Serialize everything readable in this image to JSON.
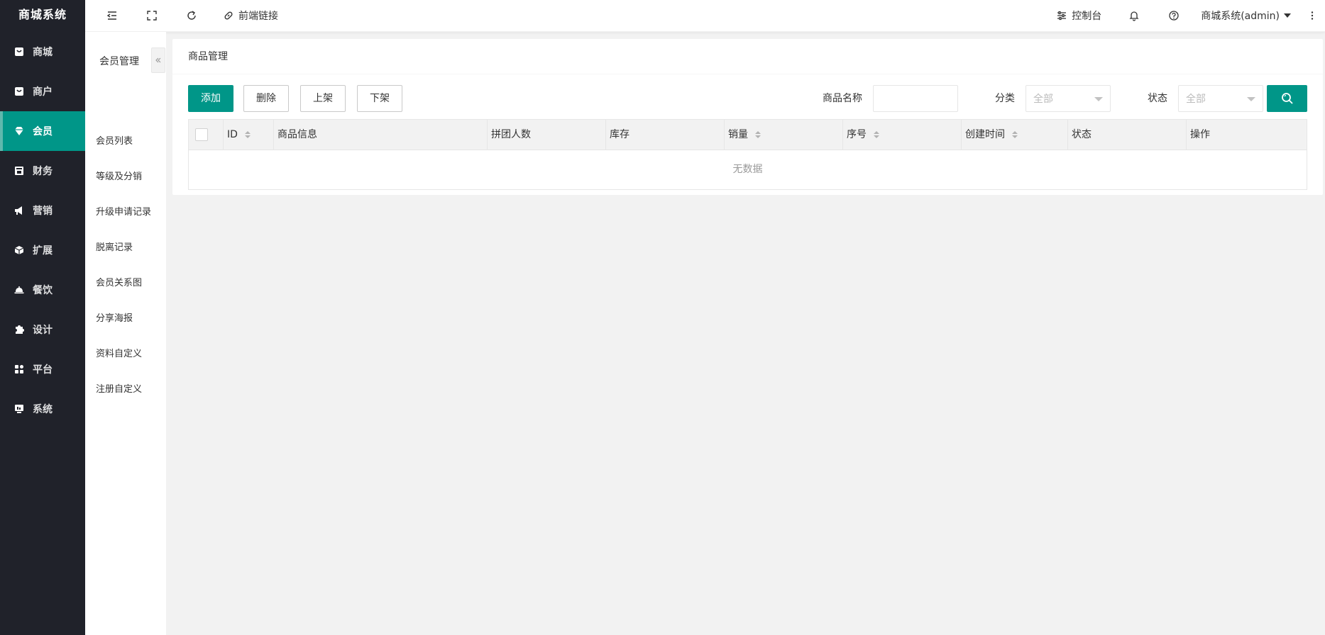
{
  "app": {
    "title": "商城系统"
  },
  "sidebar": {
    "items": [
      {
        "label": "商城",
        "icon": "shopping-bag-icon",
        "active": false
      },
      {
        "label": "商户",
        "icon": "store-icon",
        "active": false
      },
      {
        "label": "会员",
        "icon": "diamond-icon",
        "active": true
      },
      {
        "label": "财务",
        "icon": "wallet-icon",
        "active": false
      },
      {
        "label": "营销",
        "icon": "megaphone-icon",
        "active": false
      },
      {
        "label": "扩展",
        "icon": "cube-icon",
        "active": false
      },
      {
        "label": "餐饮",
        "icon": "cloche-icon",
        "active": false
      },
      {
        "label": "设计",
        "icon": "puzzle-icon",
        "active": false
      },
      {
        "label": "平台",
        "icon": "grid-icon",
        "active": false
      },
      {
        "label": "系统",
        "icon": "monitor-icon",
        "active": false
      }
    ]
  },
  "header": {
    "frontend_link": "前端链接",
    "console": "控制台",
    "user": "商城系统(admin)"
  },
  "submenu": {
    "title": "会员管理",
    "items": [
      "会员列表",
      "等级及分销",
      "升级申请记录",
      "脱离记录",
      "会员关系图",
      "分享海报",
      "资料自定义",
      "注册自定义"
    ]
  },
  "main": {
    "card_title": "商品管理",
    "buttons": {
      "add": "添加",
      "delete": "删除",
      "on_shelf": "上架",
      "off_shelf": "下架"
    },
    "filters": {
      "name_label": "商品名称",
      "name_value": "",
      "category_label": "分类",
      "category_value": "全部",
      "status_label": "状态",
      "status_value": "全部"
    },
    "table": {
      "columns": [
        "ID",
        "商品信息",
        "拼团人数",
        "库存",
        "销量",
        "序号",
        "创建时间",
        "状态",
        "操作"
      ],
      "empty_text": "无数据"
    }
  },
  "colors": {
    "accent": "#009688",
    "sidebar_bg": "#20222a"
  }
}
